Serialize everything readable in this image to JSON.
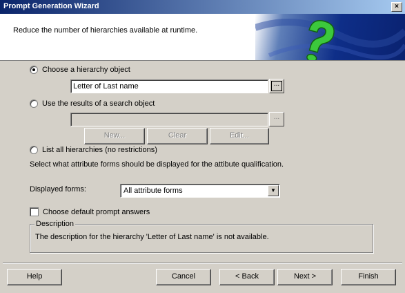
{
  "window": {
    "title": "Prompt Generation Wizard",
    "close_glyph": "×"
  },
  "header": {
    "subtitle": "Reduce the number of hierarchies available at runtime."
  },
  "options": {
    "hierarchy_object": {
      "label": "Choose a hierarchy object",
      "checked": true,
      "value": "Letter of Last name",
      "browse": "..."
    },
    "search_object": {
      "label": "Use the results of a search object",
      "checked": false,
      "value": "",
      "browse": "...",
      "buttons": {
        "new": "New...",
        "clear": "Clear",
        "edit": "Edit..."
      }
    },
    "list_all": {
      "label": "List all hierarchies (no restrictions)",
      "checked": false
    }
  },
  "forms": {
    "instruction": "Select what attribute forms should be displayed for the attibute qualification.",
    "displayed_label": "Displayed forms:",
    "displayed_value": "All attribute forms"
  },
  "default_answers": {
    "label": "Choose default prompt answers",
    "checked": false
  },
  "description": {
    "legend": "Description",
    "text": "The description for the hierarchy 'Letter of Last name' is not available."
  },
  "footer": {
    "help": "Help",
    "cancel": "Cancel",
    "back": "< Back",
    "next": "Next >",
    "finish": "Finish"
  },
  "colors": {
    "titlebar_start": "#0a246a",
    "titlebar_end": "#a6caf0",
    "face": "#d4d0c8",
    "banner_icon": "#3cc83c"
  },
  "icons": {
    "banner": "question-mark-icon"
  }
}
